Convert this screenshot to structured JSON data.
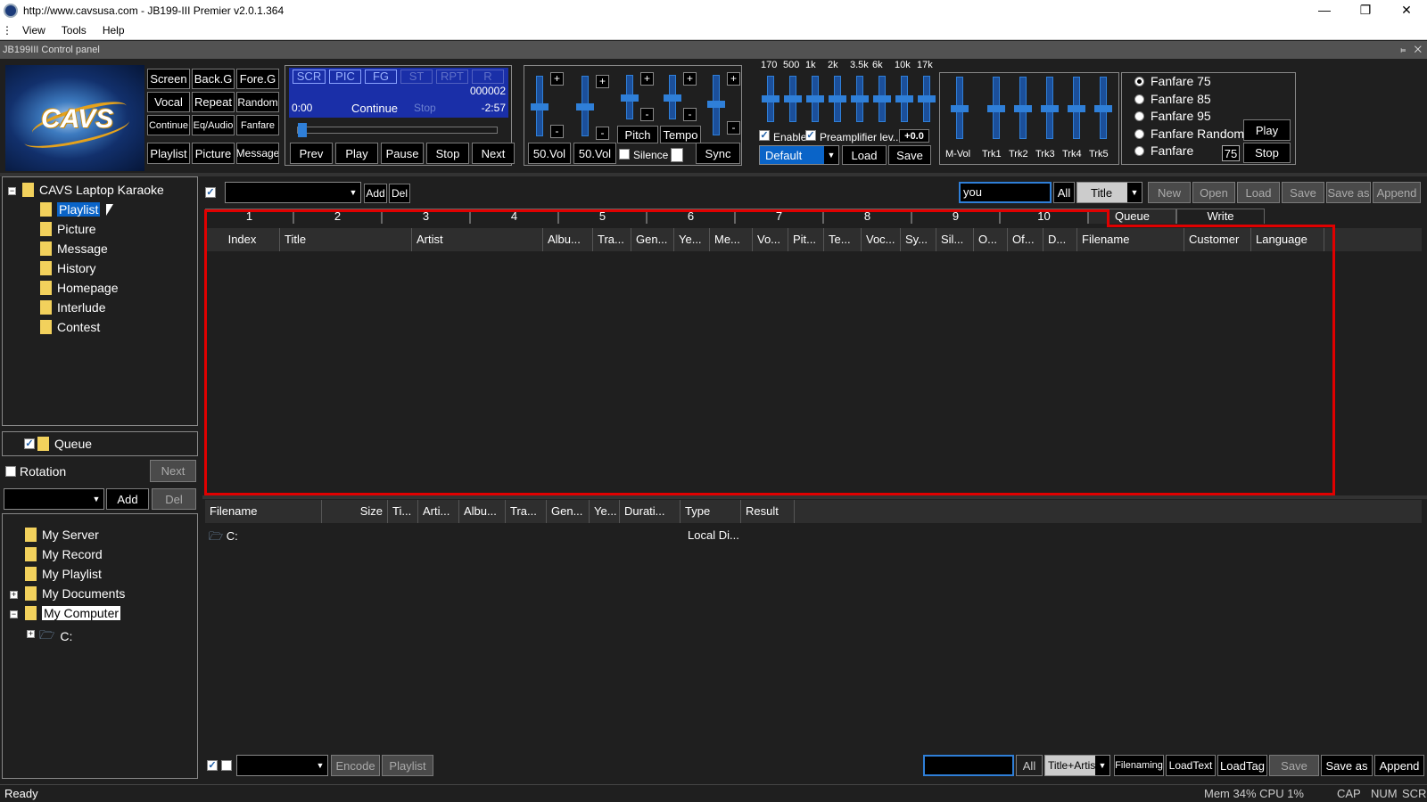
{
  "window": {
    "title": "http://www.cavsusa.com - JB199-III Premier v2.0.1.364",
    "min_icon": "minimize-icon",
    "max_icon": "restore-icon",
    "close_icon": "close-icon"
  },
  "menu": [
    "View",
    "Tools",
    "Help"
  ],
  "control_panel": {
    "title": "JB199III Control panel",
    "logo_text": "CAVS",
    "mode_buttons": [
      [
        "Screen",
        "Back.G",
        "Fore.G"
      ],
      [
        "Vocal",
        "Repeat",
        "Random"
      ],
      [
        "Continue",
        "Eq/Audio",
        "Fanfare"
      ],
      [
        "Playlist",
        "Picture",
        "Message"
      ]
    ],
    "lcd": {
      "chips": [
        "SCR",
        "PIC",
        "FG",
        "ST",
        "RPT",
        "R"
      ],
      "counter": "000002",
      "time_left": "0:00",
      "mode": "Continue",
      "state": "Stop",
      "time_right": "-2:57"
    },
    "transport": [
      "Prev",
      "Play",
      "Pause",
      "Stop",
      "Next"
    ],
    "vol_labels": [
      "50.Vol",
      "50.Vol"
    ],
    "pitch": "Pitch",
    "tempo": "Tempo",
    "silence": "Silence",
    "sync": "Sync",
    "eq_freqs": [
      "170",
      "500",
      "1k",
      "2k",
      "3.5k",
      "6k",
      "10k",
      "17k"
    ],
    "eq_enable": "Enable",
    "preamp": "Preamplifier lev...",
    "preamp_val": "+0.0",
    "eq_preset": "Default",
    "eq_load": "Load",
    "eq_save": "Save",
    "mixer_labels": [
      "M-Vol",
      "Trk1",
      "Trk2",
      "Trk3",
      "Trk4",
      "Trk5"
    ],
    "fanfare": {
      "options": [
        "Fanfare 75",
        "Fanfare 85",
        "Fanfare 95",
        "Fanfare Random",
        "Fanfare"
      ],
      "selected": 0,
      "value": "75",
      "play": "Play",
      "stop": "Stop"
    }
  },
  "tree": {
    "root": "CAVS Laptop Karaoke",
    "items": [
      "Playlist",
      "Picture",
      "Message",
      "History",
      "Homepage",
      "Interlude",
      "Contest"
    ]
  },
  "queue_panel": {
    "queue": "Queue",
    "rotation": "Rotation",
    "next": "Next",
    "add": "Add",
    "del": "Del"
  },
  "browser_tree": {
    "items": [
      "My Server",
      "My Record",
      "My Playlist",
      "My Documents",
      "My Computer"
    ],
    "drive": "C:"
  },
  "top_toolbar": {
    "add": "Add",
    "del": "Del",
    "search": "you",
    "all": "All",
    "field": "Title",
    "buttons": [
      "New",
      "Open",
      "Load",
      "Save",
      "Save as",
      "Append"
    ]
  },
  "tabs": [
    "1",
    "2",
    "3",
    "4",
    "5",
    "6",
    "7",
    "8",
    "9",
    "10",
    "Queue",
    "Write"
  ],
  "song_columns": [
    "Index",
    "Title",
    "Artist",
    "Albu...",
    "Tra...",
    "Gen...",
    "Ye...",
    "Me...",
    "Vo...",
    "Pit...",
    "Te...",
    "Voc...",
    "Sy...",
    "Sil...",
    "O...",
    "Of...",
    "D...",
    "Filename",
    "Customer",
    "Language"
  ],
  "file_columns": [
    "Filename",
    "Size",
    "Ti...",
    "Arti...",
    "Albu...",
    "Tra...",
    "Gen...",
    "Ye...",
    "Durati...",
    "Type",
    "Result"
  ],
  "file_rows": [
    {
      "name": "C:",
      "type": "Local Di..."
    }
  ],
  "bottom_toolbar": {
    "encode": "Encode",
    "playlist": "Playlist",
    "all": "All",
    "field": "Title+Artist",
    "buttons": [
      "Filenaming",
      "LoadText",
      "LoadTag",
      "Save",
      "Save as",
      "Append"
    ]
  },
  "status": {
    "ready": "Ready",
    "mem": "Mem 34% CPU  1%",
    "cap": "CAP",
    "num": "NUM",
    "scr": "SCR"
  }
}
